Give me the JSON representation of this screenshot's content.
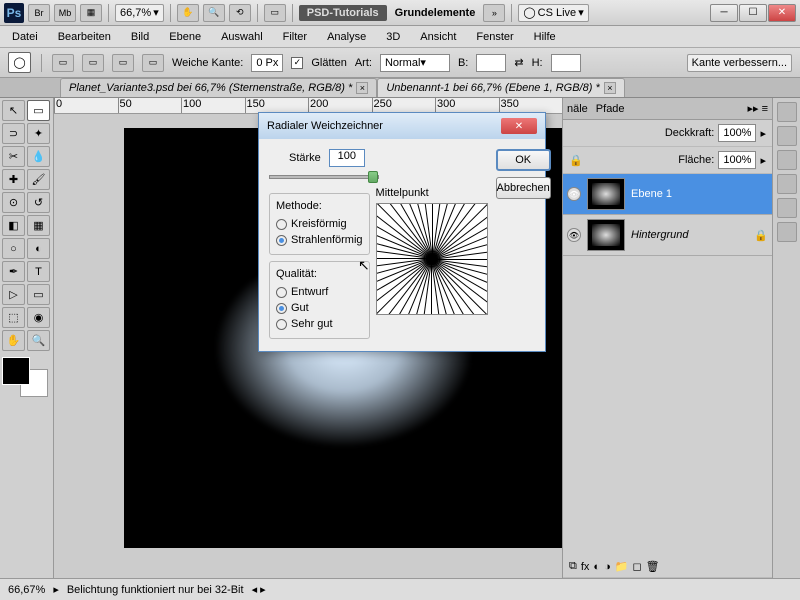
{
  "titlebar": {
    "ps": "Ps",
    "br": "Br",
    "mb": "Mb",
    "zoom": "66,7%",
    "tag": "PSD-Tutorials",
    "workspace": "Grundelemente",
    "cslive": "CS Live"
  },
  "menu": [
    "Datei",
    "Bearbeiten",
    "Bild",
    "Ebene",
    "Auswahl",
    "Filter",
    "Analyse",
    "3D",
    "Ansicht",
    "Fenster",
    "Hilfe"
  ],
  "options": {
    "weiche": "Weiche Kante:",
    "weiche_val": "0 Px",
    "glatten": "Glätten",
    "art": "Art:",
    "art_val": "Normal",
    "b": "B:",
    "h": "H:",
    "kante": "Kante verbessern..."
  },
  "tabs": [
    {
      "label": "Planet_Variante3.psd bei 66,7% (Sternenstraße, RGB/8) *"
    },
    {
      "label": "Unbenannt-1 bei 66,7% (Ebene 1, RGB/8) *"
    }
  ],
  "ruler": [
    "0",
    "50",
    "100",
    "150",
    "200",
    "250",
    "300",
    "350"
  ],
  "panels": {
    "tabs": [
      "näle",
      "Pfade"
    ],
    "deckkraft": "Deckkraft:",
    "deckkraft_val": "100%",
    "flache": "Fläche:",
    "flache_val": "100%"
  },
  "layers": [
    {
      "name": "Ebene 1"
    },
    {
      "name": "Hintergrund"
    }
  ],
  "status": {
    "zoom": "66,67%",
    "msg": "Belichtung funktioniert nur bei 32-Bit"
  },
  "dialog": {
    "title": "Radialer Weichzeichner",
    "ok": "OK",
    "cancel": "Abbrechen",
    "starke": "Stärke",
    "starke_val": "100",
    "methode": "Methode:",
    "m1": "Kreisförmig",
    "m2": "Strahlenförmig",
    "qualitat": "Qualität:",
    "q1": "Entwurf",
    "q2": "Gut",
    "q3": "Sehr gut",
    "mittelpunkt": "Mittelpunkt"
  }
}
